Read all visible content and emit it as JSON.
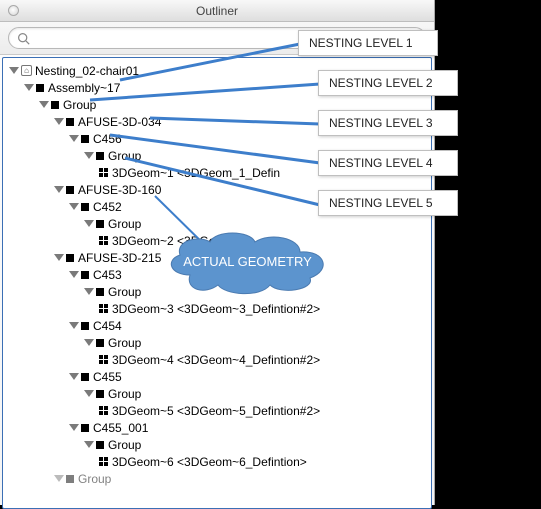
{
  "window": {
    "title": "Outliner"
  },
  "search": {
    "placeholder": ""
  },
  "tree": {
    "n0": "Nesting_02-chair01",
    "n1": "Assembly~17",
    "n2": "Group",
    "n3": "AFUSE-3D-034",
    "n4": "C456",
    "n5": "Group",
    "n6": "3DGeom~1 <3DGeom_1_Defin",
    "n7": "AFUSE-3D-160",
    "n8": "C452",
    "n9": "Group",
    "n10": "3DGeom~2 <3DGeom",
    "n11": "AFUSE-3D-215",
    "n12": "C453",
    "n13": "Group",
    "n14": "3DGeom~3 <3DGeom~3_Defintion#2>",
    "n15": "C454",
    "n16": "Group",
    "n17": "3DGeom~4 <3DGeom~4_Defintion#2>",
    "n18": "C455",
    "n19": "Group",
    "n20": "3DGeom~5 <3DGeom~5_Defintion#2>",
    "n21": "C455_001",
    "n22": "Group",
    "n23": "3DGeom~6 <3DGeom~6_Defintion>",
    "n24": "Group"
  },
  "callouts": {
    "c1": "NESTING LEVEL 1",
    "c2": "NESTING LEVEL 2",
    "c3": "NESTING LEVEL 3",
    "c4": "NESTING LEVEL 4",
    "c5": "NESTING LEVEL 5",
    "cloud": "ACTUAL GEOMETRY"
  }
}
